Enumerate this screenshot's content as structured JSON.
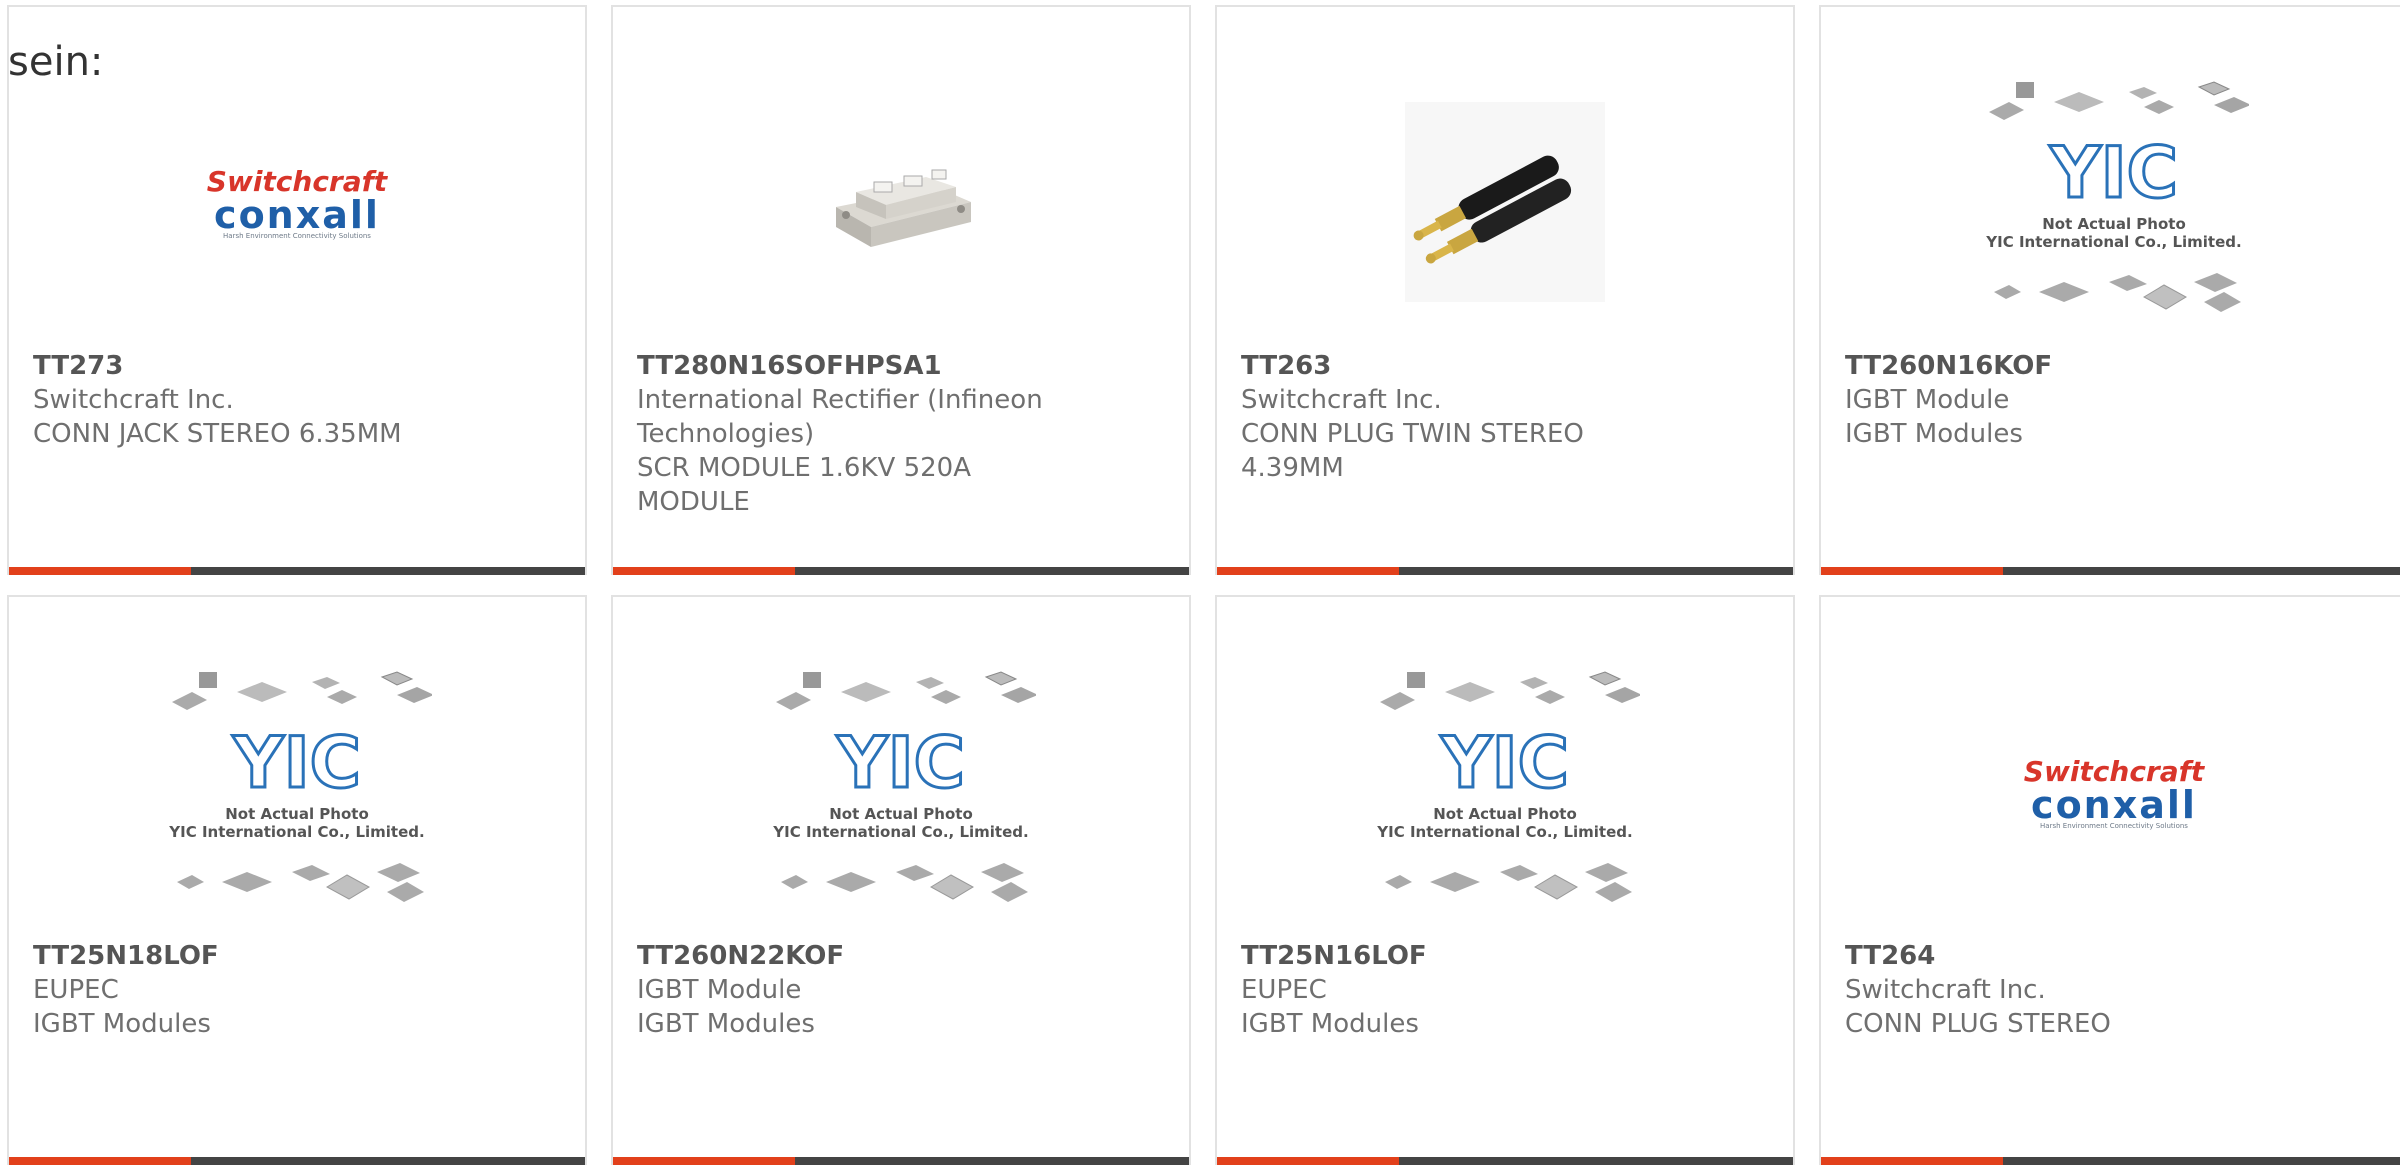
{
  "intro_text": "sein:",
  "accent_color": "#e2401b",
  "bar_color": "#444444",
  "products": [
    {
      "part": "TT273",
      "lines": [
        "Switchcraft Inc.",
        "CONN JACK STEREO 6.35MM"
      ],
      "image": "switchcraft-logo"
    },
    {
      "part": "TT280N16SOFHPSA1",
      "lines": [
        "International Rectifier (Infineon",
        "Technologies)",
        "SCR MODULE 1.6KV 520A",
        "MODULE"
      ],
      "image": "scr-module-photo"
    },
    {
      "part": "TT263",
      "lines": [
        "Switchcraft Inc.",
        "CONN PLUG TWIN STEREO",
        "4.39MM"
      ],
      "image": "twin-plug-photo"
    },
    {
      "part": "TT260N16KOF",
      "lines": [
        "IGBT Module",
        "IGBT Modules"
      ],
      "image": "yic-placeholder"
    },
    {
      "part": "TT25N18LOF",
      "lines": [
        "EUPEC",
        "IGBT Modules"
      ],
      "image": "yic-placeholder"
    },
    {
      "part": "TT260N22KOF",
      "lines": [
        "IGBT Module",
        "IGBT Modules"
      ],
      "image": "yic-placeholder"
    },
    {
      "part": "TT25N16LOF",
      "lines": [
        "EUPEC",
        "IGBT Modules"
      ],
      "image": "yic-placeholder"
    },
    {
      "part": "TT264",
      "lines": [
        "Switchcraft Inc.",
        "CONN PLUG STEREO"
      ],
      "image": "switchcraft-logo"
    }
  ],
  "logo_switchcraft": {
    "line1": "Switchcraft",
    "line2": "conxall",
    "tagline": "Harsh Environment Connectivity Solutions"
  },
  "yic_placeholder": {
    "brand": "YIC",
    "caption1": "Not Actual Photo",
    "caption2": "YIC International Co., Limited."
  }
}
